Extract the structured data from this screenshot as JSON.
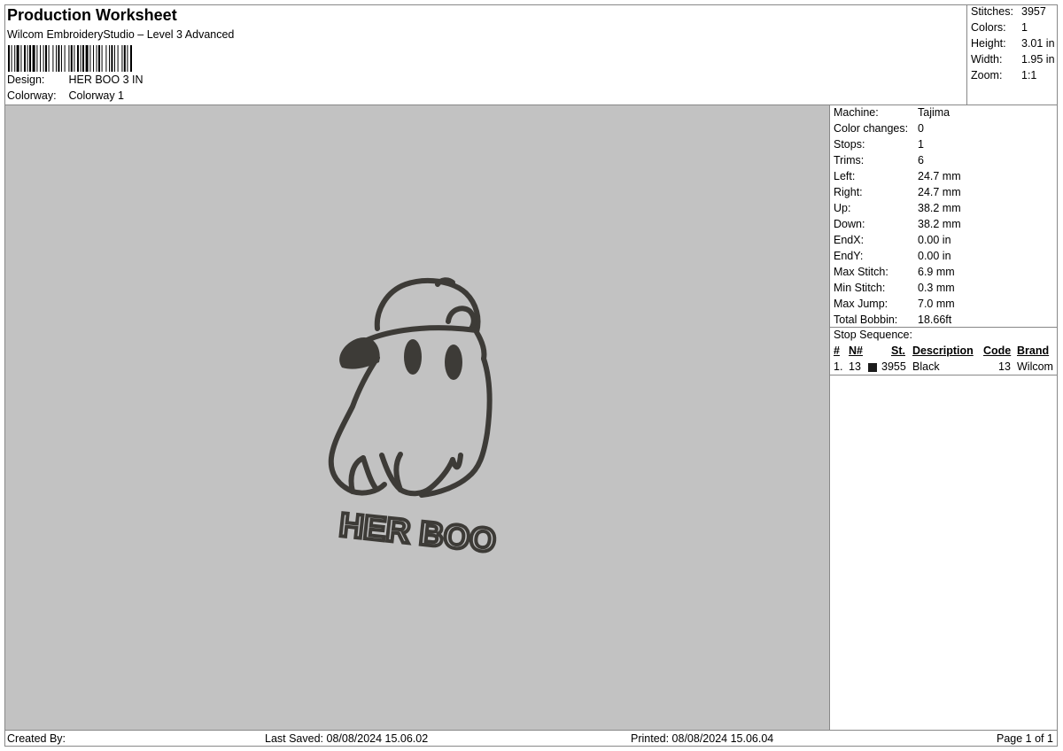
{
  "header": {
    "title": "Production Worksheet",
    "subtitle": "Wilcom EmbroideryStudio – Level 3 Advanced",
    "design_label": "Design:",
    "design_value": "HER BOO 3 IN",
    "colorway_label": "Colorway:",
    "colorway_value": "Colorway 1"
  },
  "summary": [
    {
      "label": "Stitches:",
      "value": "3957"
    },
    {
      "label": "Colors:",
      "value": "1"
    },
    {
      "label": "Height:",
      "value": "3.01 in"
    },
    {
      "label": "Width:",
      "value": "1.95 in"
    },
    {
      "label": "Zoom:",
      "value": "1:1"
    }
  ],
  "machine": [
    {
      "label": "Machine:",
      "value": "Tajima"
    },
    {
      "label": "Color changes:",
      "value": "0"
    },
    {
      "label": "Stops:",
      "value": "1"
    },
    {
      "label": "Trims:",
      "value": "6"
    },
    {
      "label": "Left:",
      "value": "24.7 mm"
    },
    {
      "label": "Right:",
      "value": "24.7 mm"
    },
    {
      "label": "Up:",
      "value": "38.2 mm"
    },
    {
      "label": "Down:",
      "value": "38.2 mm"
    },
    {
      "label": "EndX:",
      "value": "0.00 in"
    },
    {
      "label": "EndY:",
      "value": "0.00 in"
    },
    {
      "label": "Max Stitch:",
      "value": "6.9 mm"
    },
    {
      "label": "Min Stitch:",
      "value": "0.3 mm"
    },
    {
      "label": "Max Jump:",
      "value": "7.0 mm"
    },
    {
      "label": "Total Bobbin:",
      "value": "18.66ft"
    }
  ],
  "stop_sequence": {
    "title": "Stop Sequence:",
    "columns": [
      "#",
      "N#",
      "St.",
      "Description",
      "Code",
      "Brand"
    ],
    "rows": [
      {
        "num": "1.",
        "n": "13",
        "color": "#1c1c1c",
        "st": "3955",
        "description": "Black",
        "code": "13",
        "brand": "Wilcom"
      }
    ]
  },
  "design_artwork": {
    "text": "HER BOO",
    "thread_color": "#3d3b37",
    "background_color": "#c2c2c2"
  },
  "footer": {
    "created_by": "Created By:",
    "last_saved": "Last Saved: 08/08/2024 15.06.02",
    "printed": "Printed: 08/08/2024 15.06.04",
    "page": "Page 1 of 1"
  }
}
